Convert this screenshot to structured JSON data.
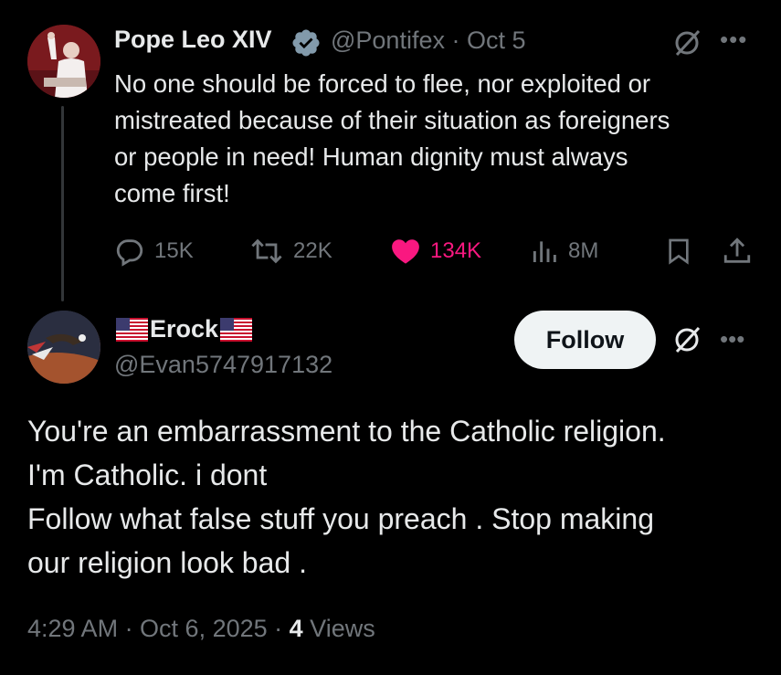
{
  "parent_tweet": {
    "author_name": "Pope Leo XIV",
    "handle_date": "@Pontifex · Oct 5",
    "text": "No one should be forced to flee, nor exploited or\nmistreated because of their situation as foreigners\nor people in need! Human dignity must always\ncome first!",
    "replies": "15K",
    "reposts": "22K",
    "likes": "134K",
    "views": "8M"
  },
  "reply_tweet": {
    "author_name": "Erock",
    "handle": "@Evan5747917132",
    "follow_label": "Follow",
    "text": "You're an embarrassment to the Catholic religion.\nI'm Catholic. i dont\nFollow what false stuff you preach . Stop making\nour religion look bad .",
    "timestamp": "4:29 AM · Oct 6, 2025 · ",
    "views_count": "4",
    "views_label": " Views"
  },
  "icons": {
    "verified": "verified-badge-icon",
    "grok": "grok-icon",
    "more": "more-icon",
    "reply": "reply-icon",
    "repost": "repost-icon",
    "like": "heart-icon",
    "views": "views-icon",
    "bookmark": "bookmark-icon",
    "share": "share-icon",
    "flag": "us-flag-icon"
  },
  "colors": {
    "background": "#000000",
    "text": "#e7e9ea",
    "muted": "#71767b",
    "like": "#f91880",
    "verified": "#829aab",
    "follow_bg": "#eff3f4"
  }
}
